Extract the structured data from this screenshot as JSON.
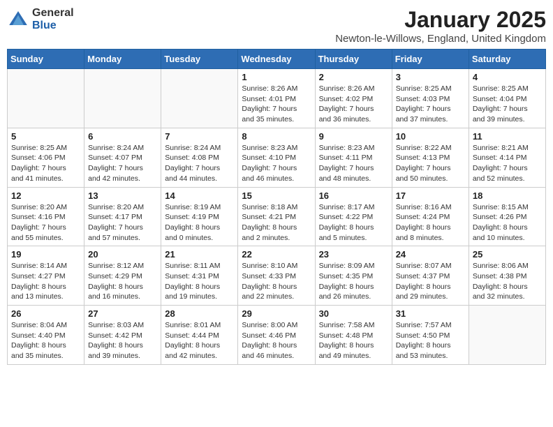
{
  "logo": {
    "general": "General",
    "blue": "Blue"
  },
  "title": "January 2025",
  "subtitle": "Newton-le-Willows, England, United Kingdom",
  "weekdays": [
    "Sunday",
    "Monday",
    "Tuesday",
    "Wednesday",
    "Thursday",
    "Friday",
    "Saturday"
  ],
  "weeks": [
    [
      {
        "day": "",
        "info": ""
      },
      {
        "day": "",
        "info": ""
      },
      {
        "day": "",
        "info": ""
      },
      {
        "day": "1",
        "info": "Sunrise: 8:26 AM\nSunset: 4:01 PM\nDaylight: 7 hours and 35 minutes."
      },
      {
        "day": "2",
        "info": "Sunrise: 8:26 AM\nSunset: 4:02 PM\nDaylight: 7 hours and 36 minutes."
      },
      {
        "day": "3",
        "info": "Sunrise: 8:25 AM\nSunset: 4:03 PM\nDaylight: 7 hours and 37 minutes."
      },
      {
        "day": "4",
        "info": "Sunrise: 8:25 AM\nSunset: 4:04 PM\nDaylight: 7 hours and 39 minutes."
      }
    ],
    [
      {
        "day": "5",
        "info": "Sunrise: 8:25 AM\nSunset: 4:06 PM\nDaylight: 7 hours and 41 minutes."
      },
      {
        "day": "6",
        "info": "Sunrise: 8:24 AM\nSunset: 4:07 PM\nDaylight: 7 hours and 42 minutes."
      },
      {
        "day": "7",
        "info": "Sunrise: 8:24 AM\nSunset: 4:08 PM\nDaylight: 7 hours and 44 minutes."
      },
      {
        "day": "8",
        "info": "Sunrise: 8:23 AM\nSunset: 4:10 PM\nDaylight: 7 hours and 46 minutes."
      },
      {
        "day": "9",
        "info": "Sunrise: 8:23 AM\nSunset: 4:11 PM\nDaylight: 7 hours and 48 minutes."
      },
      {
        "day": "10",
        "info": "Sunrise: 8:22 AM\nSunset: 4:13 PM\nDaylight: 7 hours and 50 minutes."
      },
      {
        "day": "11",
        "info": "Sunrise: 8:21 AM\nSunset: 4:14 PM\nDaylight: 7 hours and 52 minutes."
      }
    ],
    [
      {
        "day": "12",
        "info": "Sunrise: 8:20 AM\nSunset: 4:16 PM\nDaylight: 7 hours and 55 minutes."
      },
      {
        "day": "13",
        "info": "Sunrise: 8:20 AM\nSunset: 4:17 PM\nDaylight: 7 hours and 57 minutes."
      },
      {
        "day": "14",
        "info": "Sunrise: 8:19 AM\nSunset: 4:19 PM\nDaylight: 8 hours and 0 minutes."
      },
      {
        "day": "15",
        "info": "Sunrise: 8:18 AM\nSunset: 4:21 PM\nDaylight: 8 hours and 2 minutes."
      },
      {
        "day": "16",
        "info": "Sunrise: 8:17 AM\nSunset: 4:22 PM\nDaylight: 8 hours and 5 minutes."
      },
      {
        "day": "17",
        "info": "Sunrise: 8:16 AM\nSunset: 4:24 PM\nDaylight: 8 hours and 8 minutes."
      },
      {
        "day": "18",
        "info": "Sunrise: 8:15 AM\nSunset: 4:26 PM\nDaylight: 8 hours and 10 minutes."
      }
    ],
    [
      {
        "day": "19",
        "info": "Sunrise: 8:14 AM\nSunset: 4:27 PM\nDaylight: 8 hours and 13 minutes."
      },
      {
        "day": "20",
        "info": "Sunrise: 8:12 AM\nSunset: 4:29 PM\nDaylight: 8 hours and 16 minutes."
      },
      {
        "day": "21",
        "info": "Sunrise: 8:11 AM\nSunset: 4:31 PM\nDaylight: 8 hours and 19 minutes."
      },
      {
        "day": "22",
        "info": "Sunrise: 8:10 AM\nSunset: 4:33 PM\nDaylight: 8 hours and 22 minutes."
      },
      {
        "day": "23",
        "info": "Sunrise: 8:09 AM\nSunset: 4:35 PM\nDaylight: 8 hours and 26 minutes."
      },
      {
        "day": "24",
        "info": "Sunrise: 8:07 AM\nSunset: 4:37 PM\nDaylight: 8 hours and 29 minutes."
      },
      {
        "day": "25",
        "info": "Sunrise: 8:06 AM\nSunset: 4:38 PM\nDaylight: 8 hours and 32 minutes."
      }
    ],
    [
      {
        "day": "26",
        "info": "Sunrise: 8:04 AM\nSunset: 4:40 PM\nDaylight: 8 hours and 35 minutes."
      },
      {
        "day": "27",
        "info": "Sunrise: 8:03 AM\nSunset: 4:42 PM\nDaylight: 8 hours and 39 minutes."
      },
      {
        "day": "28",
        "info": "Sunrise: 8:01 AM\nSunset: 4:44 PM\nDaylight: 8 hours and 42 minutes."
      },
      {
        "day": "29",
        "info": "Sunrise: 8:00 AM\nSunset: 4:46 PM\nDaylight: 8 hours and 46 minutes."
      },
      {
        "day": "30",
        "info": "Sunrise: 7:58 AM\nSunset: 4:48 PM\nDaylight: 8 hours and 49 minutes."
      },
      {
        "day": "31",
        "info": "Sunrise: 7:57 AM\nSunset: 4:50 PM\nDaylight: 8 hours and 53 minutes."
      },
      {
        "day": "",
        "info": ""
      }
    ]
  ]
}
